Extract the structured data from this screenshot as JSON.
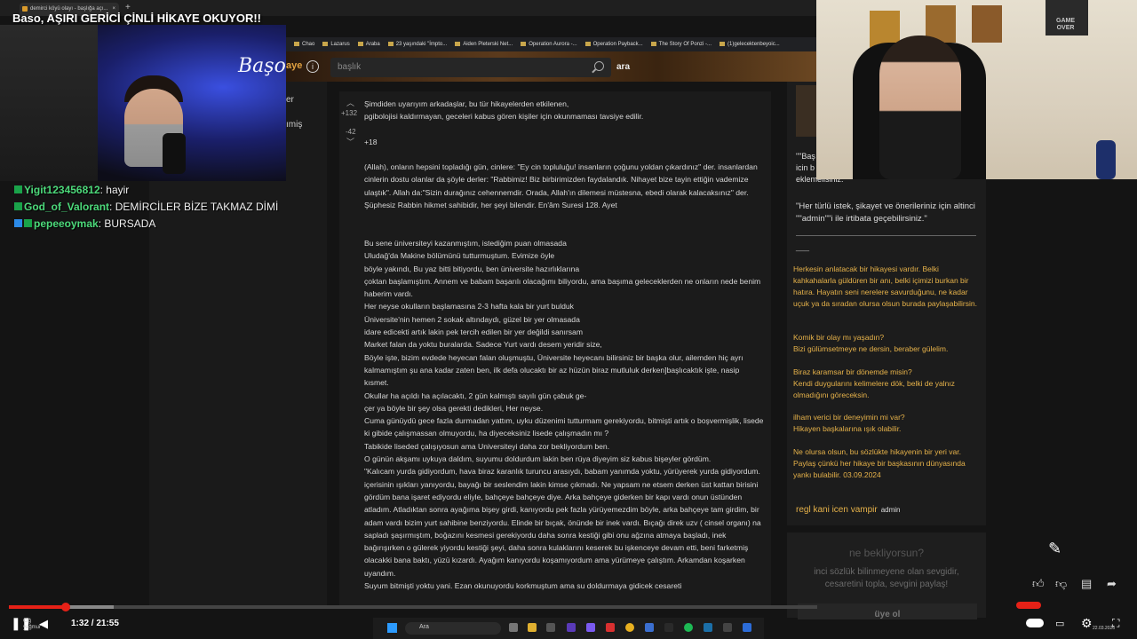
{
  "window": {
    "title": "Baso, AŞIRI GERİCİ ÇİNLİ HİKAYE OKUYOR!!",
    "tab_label": "demirci köyü olayı - başlığa açı...",
    "tab_close": "×",
    "new_tab": "+"
  },
  "bookmarks": [
    "Chao",
    "Lazarus",
    "Araba",
    "23 yaşındaki \"İmpto...",
    "Aiden Pleterski Net...",
    "Operation Aurora -...",
    "Operation Payback...",
    "The Story Of Ponzi -...",
    "(1)gelecektenbeyoic..."
  ],
  "site": {
    "logo_fragment": "aye",
    "info_icon": "i",
    "search_placeholder": "başlık",
    "search_button": "ara",
    "nav_items": [
      "er",
      "ımiş"
    ]
  },
  "entry": {
    "upvote_count": "+132",
    "downvote_count": "-42",
    "paragraphs": [
      "Şimdiden uyarıyım arkadaşlar, bu tür hikayelerden etkilenen,\npgibolojisi kaldırmayan, geceleri kabus gören kişiler için okunmaması tavsiye edilir.",
      "+18",
      "(Allah), onların hepsini topladığı gün, cinlere: \"Ey cin topluluğu! insanların çoğunu yoldan çıkardınız\" der. insanlardan cinlerin dostu olanlar da şöyle derler: \"Rabbimiz! Biz birbirimizden faydalandık. Nihayet bize tayin ettiğin vademize ulaştık\". Allah da:\"Sizin durağınız cehennemdir. Orada, Allah'ın dilemesi müstesna, ebedi olarak kalacaksınız\" der. Şüphesiz Rabbin hikmet sahibidir, her şeyi bilendir. En'âm Suresi 128. Ayet",
      "Bu sene üniversiteyi kazanmıştım, istediğim puan olmasada\nUludağ'da Makine bölümünü tutturmuştum. Evimize öyle\nböyle yakındı, Bu yaz bitti bitiyordu, ben üniversite hazırlıklarına\nçoktan başlamıştım. Annem ve babam başarılı olacağımı biliyordu, ama başıma geleceklerden ne onların nede benim haberim vardı.\nHer neyse okulların başlamasına 2-3 hafta kala bir yurt bulduk\nÜniversite'nin hemen 2 sokak altındaydı, güzel bir yer olmasada\nidare edicekti artık lakin pek tercih edilen bir yer değildi sanırsam\nMarket falan da yoktu buralarda. Sadece Yurt vardı desem yeridir size,\nBöyle işte, bizim evdede heyecan falan oluşmuştu, Üniversite heyecanı bilirsiniz bir başka olur, ailemden hiç ayrı kalmamıştım şu ana kadar zaten ben, ilk defa olucaktı bir az hüzün biraz mutluluk derken]başlıcaktık işte, nasip kısmet.\nOkullar ha açıldı ha açılacaktı, 2 gün kalmıştı sayılı gün çabuk ge-\nçer ya böyle bir şey olsa gerekti dedikleri, Her neyse.\nCuma günüydü gece fazla durmadan yattım, uyku düzenimi tutturmam gerekiyordu, bitmişti artık o boşvermişlik, lisede ki gibide çalışmassan olmuyordu, ha diyeceksiniz lisede çalışmadın mı ?\nTabikide liseded çalışıyosun ama Universiteyi daha zor bekliyordum ben.\nO günün akşamı uykuya daldım, suyumu doldurdum lakin ben rüya diyeyim siz kabus bişeyler gördüm.\n\"Kalıcam yurda gidiyordum, hava biraz karanlık turuncu arasıydı, babam yanımda yoktu, yürüyerek yurda gidiyordum. içerisinin ışıkları yanıyordu, bayağı bir seslendim lakin kimse çıkmadı. Ne yapsam ne etsem derken üst kattan birisini gördüm bana işaret ediyordu eliyle, bahçeye bahçeye diye. Arka bahçeye giderken bir kapı vardı onun üstünden atladım. Atladıktan sonra ayağıma bişey girdi, kanıyordu pek fazla yürüyemezdim böyle, arka bahçeye tam girdim, bir adam vardı bizim yurt sahibine benziyordu. Elinde bir bıçak, önünde bir inek vardı. Bıçağı direk uzv ( cinsel organı) na sapladı şaşırmıştım, boğazını kesmesi gerekiyordu daha sonra kestiği gibi onu ağzına atmaya başladı, inek bağırışırken o gülerek yiyordu kestiği şeyi, daha sonra kulaklarını keserek bu işkenceye devam etti, beni farketmiş olacakki bana baktı, yüzü kızardı. Ayağım kanıyordu koşamıyordum ama yürümeye çalıştım. Arkamdan koşarken uyandım.\nSuyum bitmişti yoktu yani. Ezan okunuyordu korkmuştum ama su doldurmaya gidicek cesareti"
    ]
  },
  "sidebar": {
    "quote_fragment": "\"\"Baş\nicin b\neklemelisiniz.\"",
    "contact_text": "\"Her türlü istek, şikayet ve önerileriniz için altinci \"\"admin\"\"i ile irtibata geçebilirsiniz.\"",
    "dash": "___",
    "paragraphs": [
      "Herkesin anlatacak bir hikayesi vardır. Belki kahkahalarla güldüren bir anı, belki içimizi burkan bir hatıra. Hayatın seni nerelere savurduğunu, ne kadar uçuk ya da sıradan olursa olsun burada paylaşabilirsin.",
      "Komik bir olay mı yaşadın?\nBizi gülümsetmeye ne dersin, beraber gülelim.",
      "Biraz karamsar bir dönemde misin?\nKendi duygularını kelimelere dök, belki de yalnız olmadığını göreceksin.",
      "ilham verici bir deneyimin mi var?\nHikayen başkalarına ışık olabilir.",
      "Ne olursa olsun, bu sözlükte hikayenin bir yeri var. Paylaş çünkü her hikaye bir başkasının dünyasında yankı bulabilir. 03.09.2024"
    ],
    "signature": "regl kani icen vampir",
    "signature_role": "admin",
    "promo_title": "ne bekliyorsun?",
    "promo_text": "inci sözlük bilinmeyene olan sevgidir, cesaretini topla, sevgini paylaş!",
    "promo_button": "üye ol"
  },
  "chat": [
    {
      "user": "Yigit123456812",
      "message": "hayir"
    },
    {
      "user": "God_of_Valorant",
      "message": "DEMİRCİLER BİZE TAKMAZ DİMİ"
    },
    {
      "user": "pepeeoymak",
      "message": "BURSADA"
    }
  ],
  "streamer_cam": {
    "logo_text": "Başo"
  },
  "poster_text": "GAME\nOVER",
  "player": {
    "time": "1:32 / 21:55",
    "progress_fraction": 0.07,
    "buffer_fraction": 0.13,
    "stamp": "Ciğ\nyağmur",
    "clock": "22.03.2026"
  },
  "taskbar": {
    "search_placeholder": "Ara"
  },
  "icons": {
    "search": "search-icon",
    "play_pause": "pause-icon",
    "volume": "volume-icon",
    "like": "thumbs-up-icon",
    "dislike": "thumbs-down-icon",
    "comment": "comment-icon",
    "share": "share-icon",
    "settings": "gear-icon",
    "fullscreen": "fullscreen-icon"
  },
  "colors": {
    "accent_red": "#e62117",
    "sidebar_yellow": "#e6b24a",
    "chat_username": "#4cd97a"
  }
}
